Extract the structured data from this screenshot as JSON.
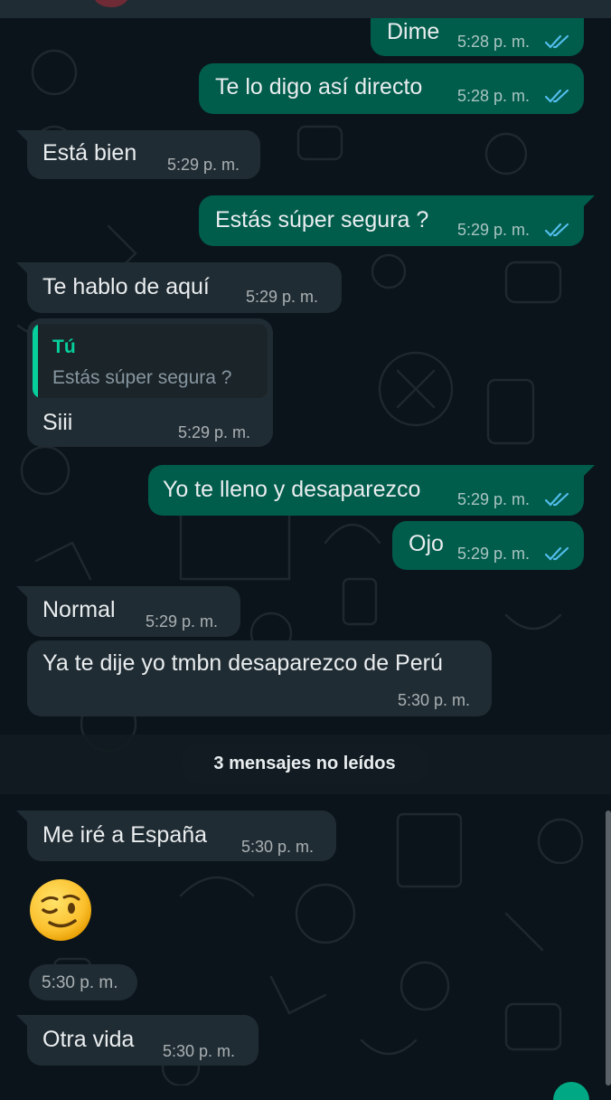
{
  "unread_divider": "3 mensajes no leídos",
  "reply_quote": {
    "author": "Tú",
    "text": "Estás súper segura ?"
  },
  "messages": [
    {
      "text": "Dime",
      "time": "5:28 p. m.",
      "direction": "outgoing",
      "status": "read"
    },
    {
      "text": "Te lo digo así directo",
      "time": "5:28 p. m.",
      "direction": "outgoing",
      "status": "read"
    },
    {
      "text": "Está bien",
      "time": "5:29 p. m.",
      "direction": "incoming"
    },
    {
      "text": "Estás súper segura ?",
      "time": "5:29 p. m.",
      "direction": "outgoing",
      "status": "read"
    },
    {
      "text": "Te hablo de aquí",
      "time": "5:29 p. m.",
      "direction": "incoming"
    },
    {
      "text": "Siii",
      "time": "5:29 p. m.",
      "direction": "incoming"
    },
    {
      "text": "Yo te lleno y desaparezco",
      "time": "5:29 p. m.",
      "direction": "outgoing",
      "status": "read"
    },
    {
      "text": "Ojo",
      "time": "5:29 p. m.",
      "direction": "outgoing",
      "status": "read"
    },
    {
      "text": "Normal",
      "time": "5:29 p. m.",
      "direction": "incoming"
    },
    {
      "text": "Ya te dije yo tmbn desaparezco de Perú",
      "time": "5:30 p. m.",
      "direction": "incoming"
    },
    {
      "text": "Me iré a España",
      "time": "5:30 p. m.",
      "direction": "incoming"
    },
    {
      "emoji": "winking-face",
      "time": "5:30 p. m.",
      "direction": "incoming"
    },
    {
      "text": "Otra vida",
      "time": "5:30 p. m.",
      "direction": "incoming"
    }
  ],
  "colors": {
    "background": "#0b141a",
    "incoming_bubble": "#202c33",
    "outgoing_bubble": "#005c4b",
    "read_ticks": "#53bdeb",
    "quote_accent": "#06cf9c"
  }
}
